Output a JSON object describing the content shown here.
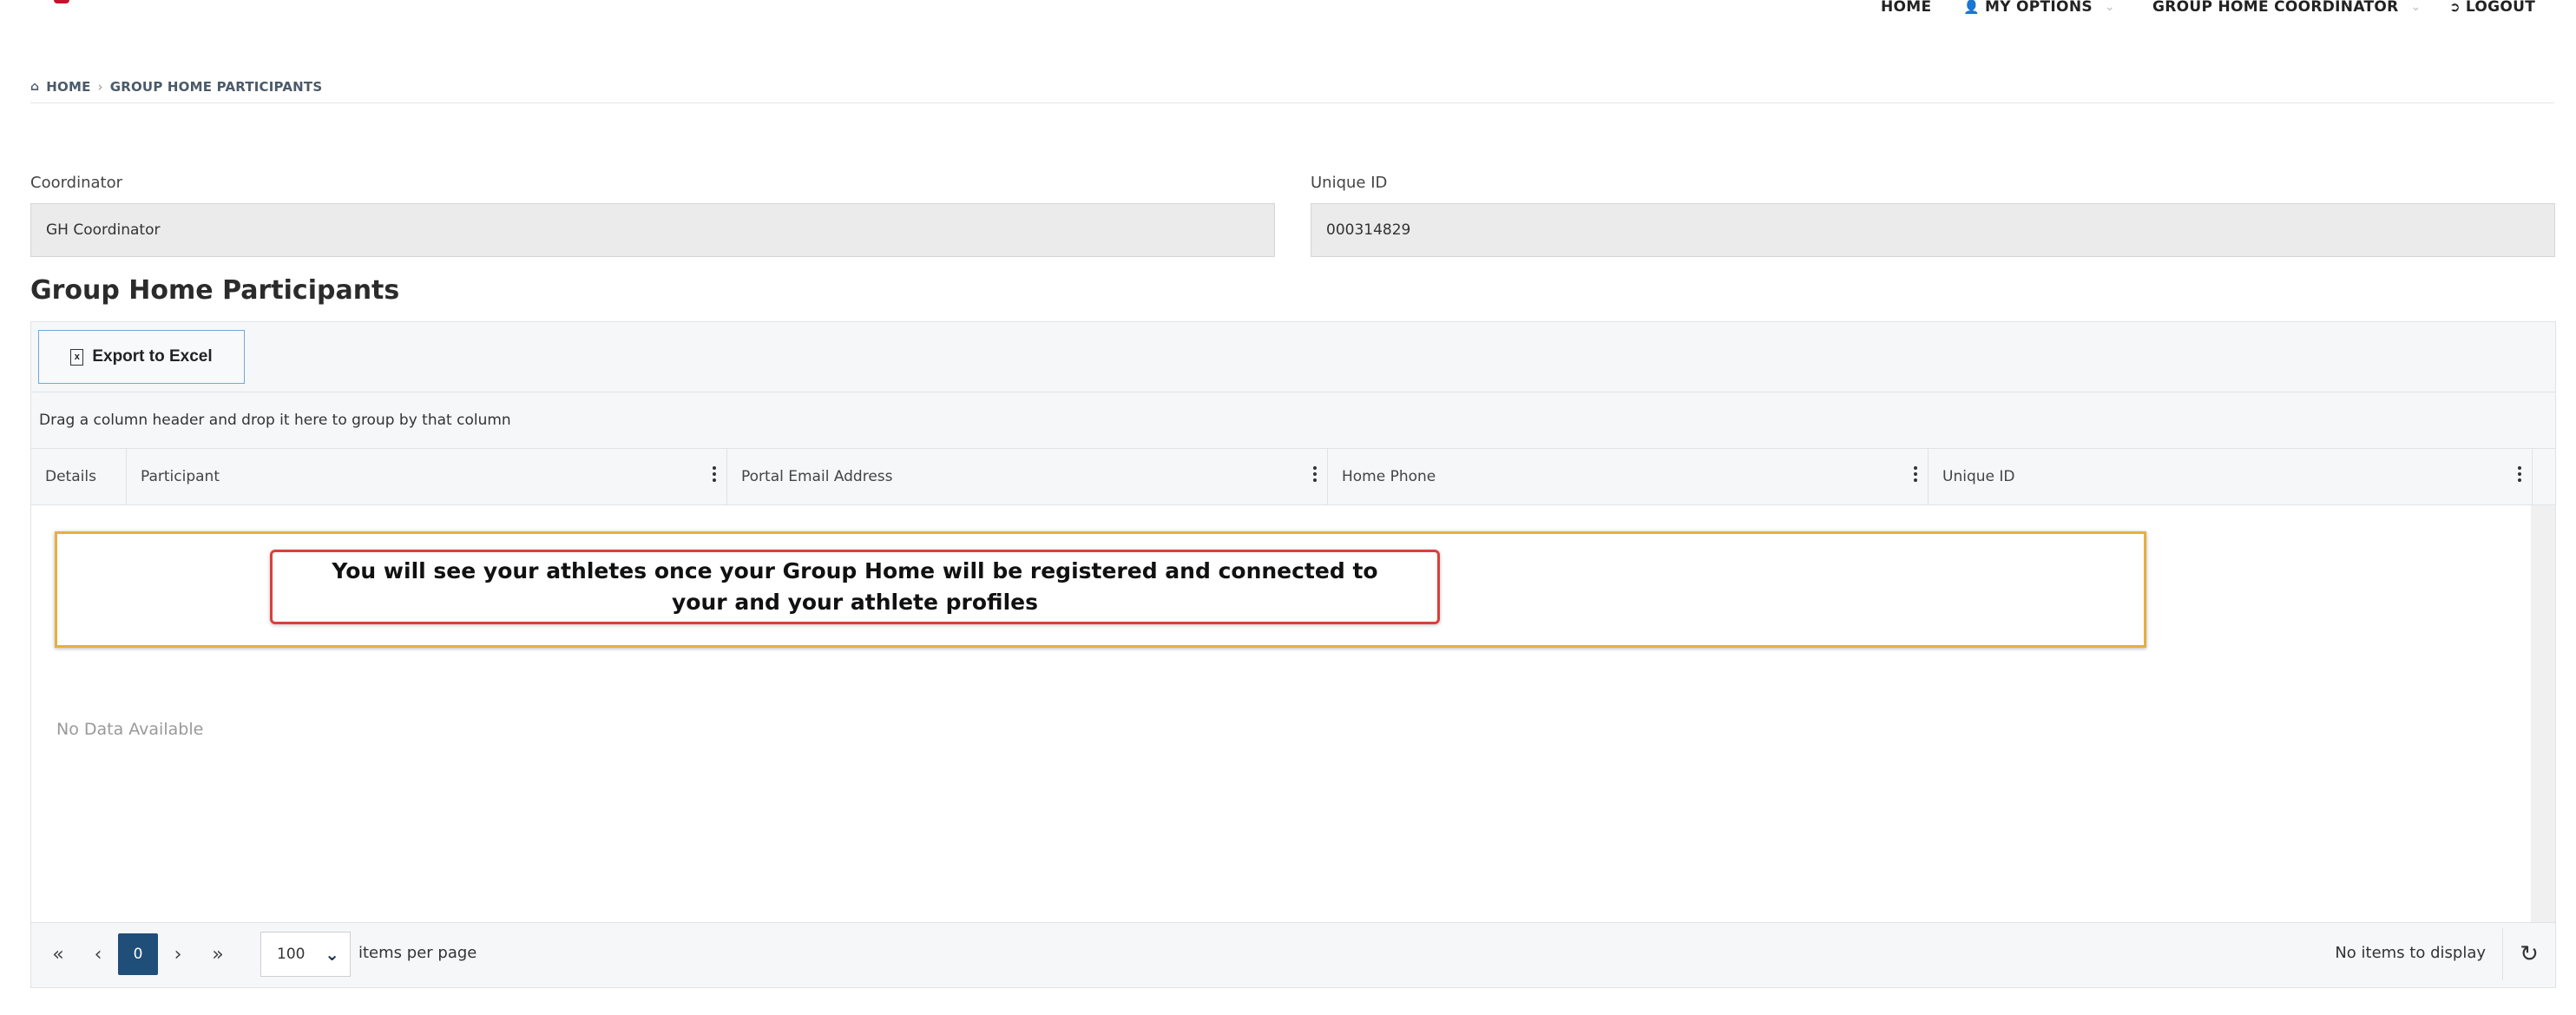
{
  "nav": {
    "home": "HOME",
    "my_options": "MY OPTIONS",
    "role": "GROUP HOME COORDINATOR",
    "logout": "LOGOUT"
  },
  "breadcrumb": {
    "home": "HOME",
    "current": "GROUP HOME PARTICIPANTS"
  },
  "form": {
    "coordinator_label": "Coordinator",
    "coordinator_value": "GH Coordinator",
    "unique_id_label": "Unique ID",
    "unique_id_value": "000314829"
  },
  "section_title": "Group Home Participants",
  "grid": {
    "export_label": "Export to Excel",
    "group_hint": "Drag a column header and drop it here to group by that column",
    "columns": [
      "Details",
      "Participant",
      "Portal Email Address",
      "Home Phone",
      "Unique ID"
    ],
    "notice": "You will see your athletes once your Group Home will be registered and connected to your and your athlete profiles",
    "no_data": "No Data Available"
  },
  "pager": {
    "current_page": "0",
    "page_size": "100",
    "per_page_label": "items per page",
    "info": "No items to display"
  },
  "colors": {
    "accent": "#1f4e79",
    "notice_border_outer": "#e4b040",
    "notice_border_inner": "#d9403a"
  }
}
